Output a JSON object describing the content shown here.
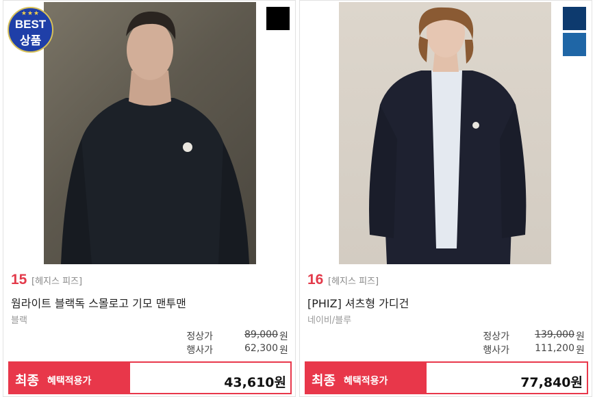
{
  "products": [
    {
      "rank": "15",
      "brand": "[헤지스 피즈]",
      "name": "웜라이트 블랙독 스몰로고 기모 맨투맨",
      "color_name": "블랙",
      "badge": {
        "line1": "BEST",
        "line2": "상품",
        "stars": "★★★"
      },
      "swatches": [
        "#000000"
      ],
      "regular_label": "정상가",
      "regular_price": "89,000",
      "event_label": "행사가",
      "event_price": "62,300",
      "currency": "원",
      "final_label_big": "최종",
      "final_label_small": "혜택적용가",
      "final_price": "43,610원"
    },
    {
      "rank": "16",
      "brand": "[헤지스 피즈]",
      "name": "[PHIZ] 셔츠형 가디건",
      "color_name": "네이비/블루",
      "swatches": [
        "#0d3a6e",
        "#1f66a6"
      ],
      "regular_label": "정상가",
      "regular_price": "139,000",
      "event_label": "행사가",
      "event_price": "111,200",
      "currency": "원",
      "final_label_big": "최종",
      "final_label_small": "혜택적용가",
      "final_price": "77,840원"
    }
  ]
}
